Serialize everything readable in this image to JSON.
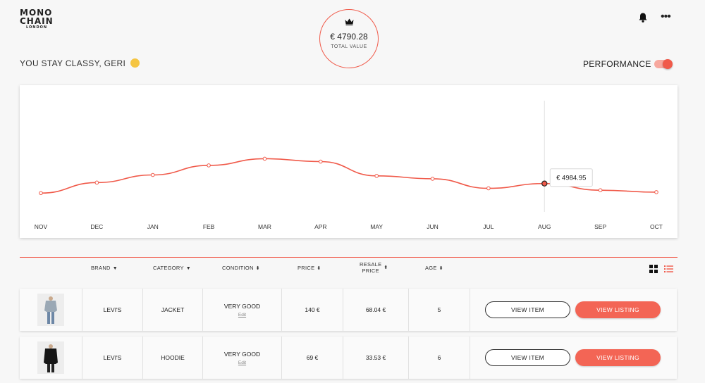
{
  "brand": {
    "line1": "MONO",
    "line2": "CHAIN",
    "line3": "LONDON"
  },
  "header": {
    "total_value": "€ 4790.28",
    "total_label": "TOTAL VALUE"
  },
  "greeting": {
    "text": "YOU STAY CLASSY, GERI"
  },
  "performance": {
    "label": "PERFORMANCE",
    "enabled": true
  },
  "colors": {
    "accent": "#f05a4a",
    "button_fill": "#f36555"
  },
  "chart_data": {
    "type": "line",
    "categories": [
      "NOV",
      "DEC",
      "JAN",
      "FEB",
      "MAR",
      "APR",
      "MAY",
      "JUN",
      "JUL",
      "AUG",
      "SEP",
      "OCT"
    ],
    "values": [
      4935,
      4990,
      5030,
      5080,
      5115,
      5100,
      5025,
      5010,
      4960,
      4984.95,
      4950,
      4940
    ],
    "tooltip": {
      "category": "AUG",
      "label": "€ 4984.95"
    },
    "grid": false,
    "legend": "none"
  },
  "table": {
    "headers": {
      "brand": "BRAND",
      "category": "CATEGORY",
      "condition": "CONDITION",
      "price": "PRICE",
      "resale_line1": "RESALE",
      "resale_line2": "PRICE",
      "age": "AGE"
    },
    "rows": [
      {
        "brand": "LEVI'S",
        "category": "JACKET",
        "condition": "VERY GOOD",
        "edit": "Edit",
        "price": "140 €",
        "resale": "68.04 €",
        "age": "5",
        "view_item": "VIEW ITEM",
        "view_listing": "VIEW LISTING"
      },
      {
        "brand": "LEVI'S",
        "category": "HOODIE",
        "condition": "VERY GOOD",
        "edit": "Edit",
        "price": "69 €",
        "resale": "33.53 €",
        "age": "6",
        "view_item": "VIEW ITEM",
        "view_listing": "VIEW LISTING"
      }
    ]
  }
}
